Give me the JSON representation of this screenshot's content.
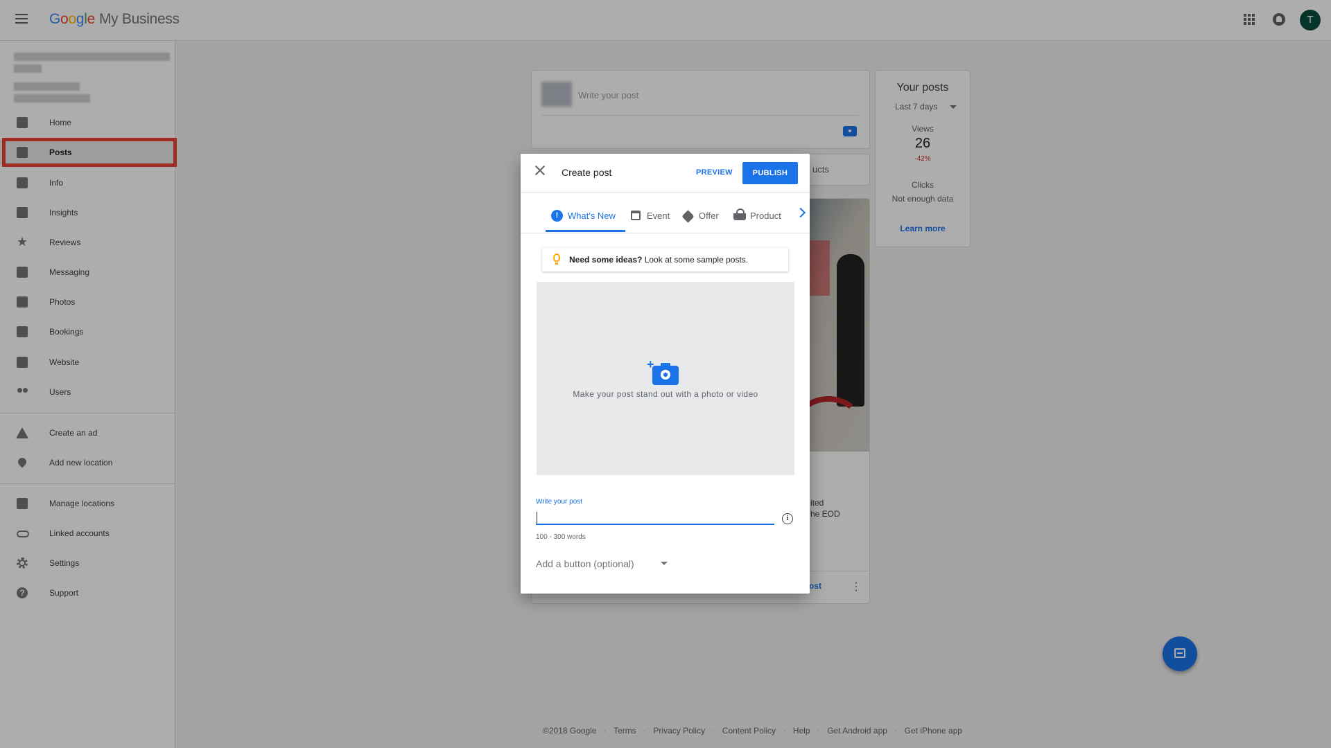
{
  "topbar": {
    "logo": {
      "g1": "G",
      "g2": "o",
      "g3": "o",
      "g4": "g",
      "g5": "l",
      "g6": "e",
      "product": "My Business"
    },
    "avatar_letter": "T"
  },
  "sidebar": {
    "items": [
      {
        "label": "Home",
        "icon": "dashboard-icon"
      },
      {
        "label": "Posts",
        "icon": "posts-icon",
        "active": true
      },
      {
        "label": "Info",
        "icon": "storefront-icon"
      },
      {
        "label": "Insights",
        "icon": "bar-chart-icon"
      },
      {
        "label": "Reviews",
        "icon": "star-icon"
      },
      {
        "label": "Messaging",
        "icon": "chat-icon"
      },
      {
        "label": "Photos",
        "icon": "photo-library-icon"
      },
      {
        "label": "Bookings",
        "icon": "calendar-icon"
      },
      {
        "label": "Website",
        "icon": "web-icon"
      },
      {
        "label": "Users",
        "icon": "people-icon"
      },
      {
        "label": "Create an ad",
        "icon": "google-ads-icon"
      },
      {
        "label": "Add new location",
        "icon": "location-pin-icon"
      },
      {
        "label": "Manage locations",
        "icon": "building-icon"
      },
      {
        "label": "Linked accounts",
        "icon": "link-icon"
      },
      {
        "label": "Settings",
        "icon": "gear-icon"
      },
      {
        "label": "Support",
        "icon": "help-icon"
      }
    ]
  },
  "composer": {
    "placeholder": "Write your post"
  },
  "tabs_card": {
    "partial_label": "ucts"
  },
  "post_card": {
    "text_line1": "ited",
    "text_line2": "he EOD",
    "action_partial": "ost"
  },
  "stats": {
    "title": "Your posts",
    "range": "Last 7 days",
    "views_label": "Views",
    "views_value": "26",
    "views_change": "-42%",
    "clicks_label": "Clicks",
    "clicks_value": "Not enough data",
    "learn_more": "Learn more"
  },
  "footer": {
    "copyright": "©2018 Google",
    "links": [
      "Terms",
      "Privacy Policy",
      "Content Policy",
      "Help",
      "Get Android app",
      "Get iPhone app"
    ],
    "separator": "·"
  },
  "dialog": {
    "title": "Create post",
    "preview_label": "PREVIEW",
    "publish_label": "PUBLISH",
    "tabs": [
      {
        "label": "What's New",
        "icon": "info-badge-icon",
        "active": true
      },
      {
        "label": "Event",
        "icon": "calendar-icon"
      },
      {
        "label": "Offer",
        "icon": "tag-icon"
      },
      {
        "label": "Product",
        "icon": "basket-icon"
      }
    ],
    "ideas_bold": "Need some ideas?",
    "ideas_text": " Look at some sample posts.",
    "media_prompt": "Make your post stand out with a photo or video",
    "post_field_label": "Write your post",
    "post_field_value": "",
    "post_field_hint": "100 - 300 words",
    "add_button_placeholder": "Add a button (optional)",
    "info_glyph": "i",
    "info_badge_glyph": "!"
  },
  "colors": {
    "accent": "#1a73e8",
    "highlight_box": "#ea4335",
    "negative_change": "#d93025"
  }
}
